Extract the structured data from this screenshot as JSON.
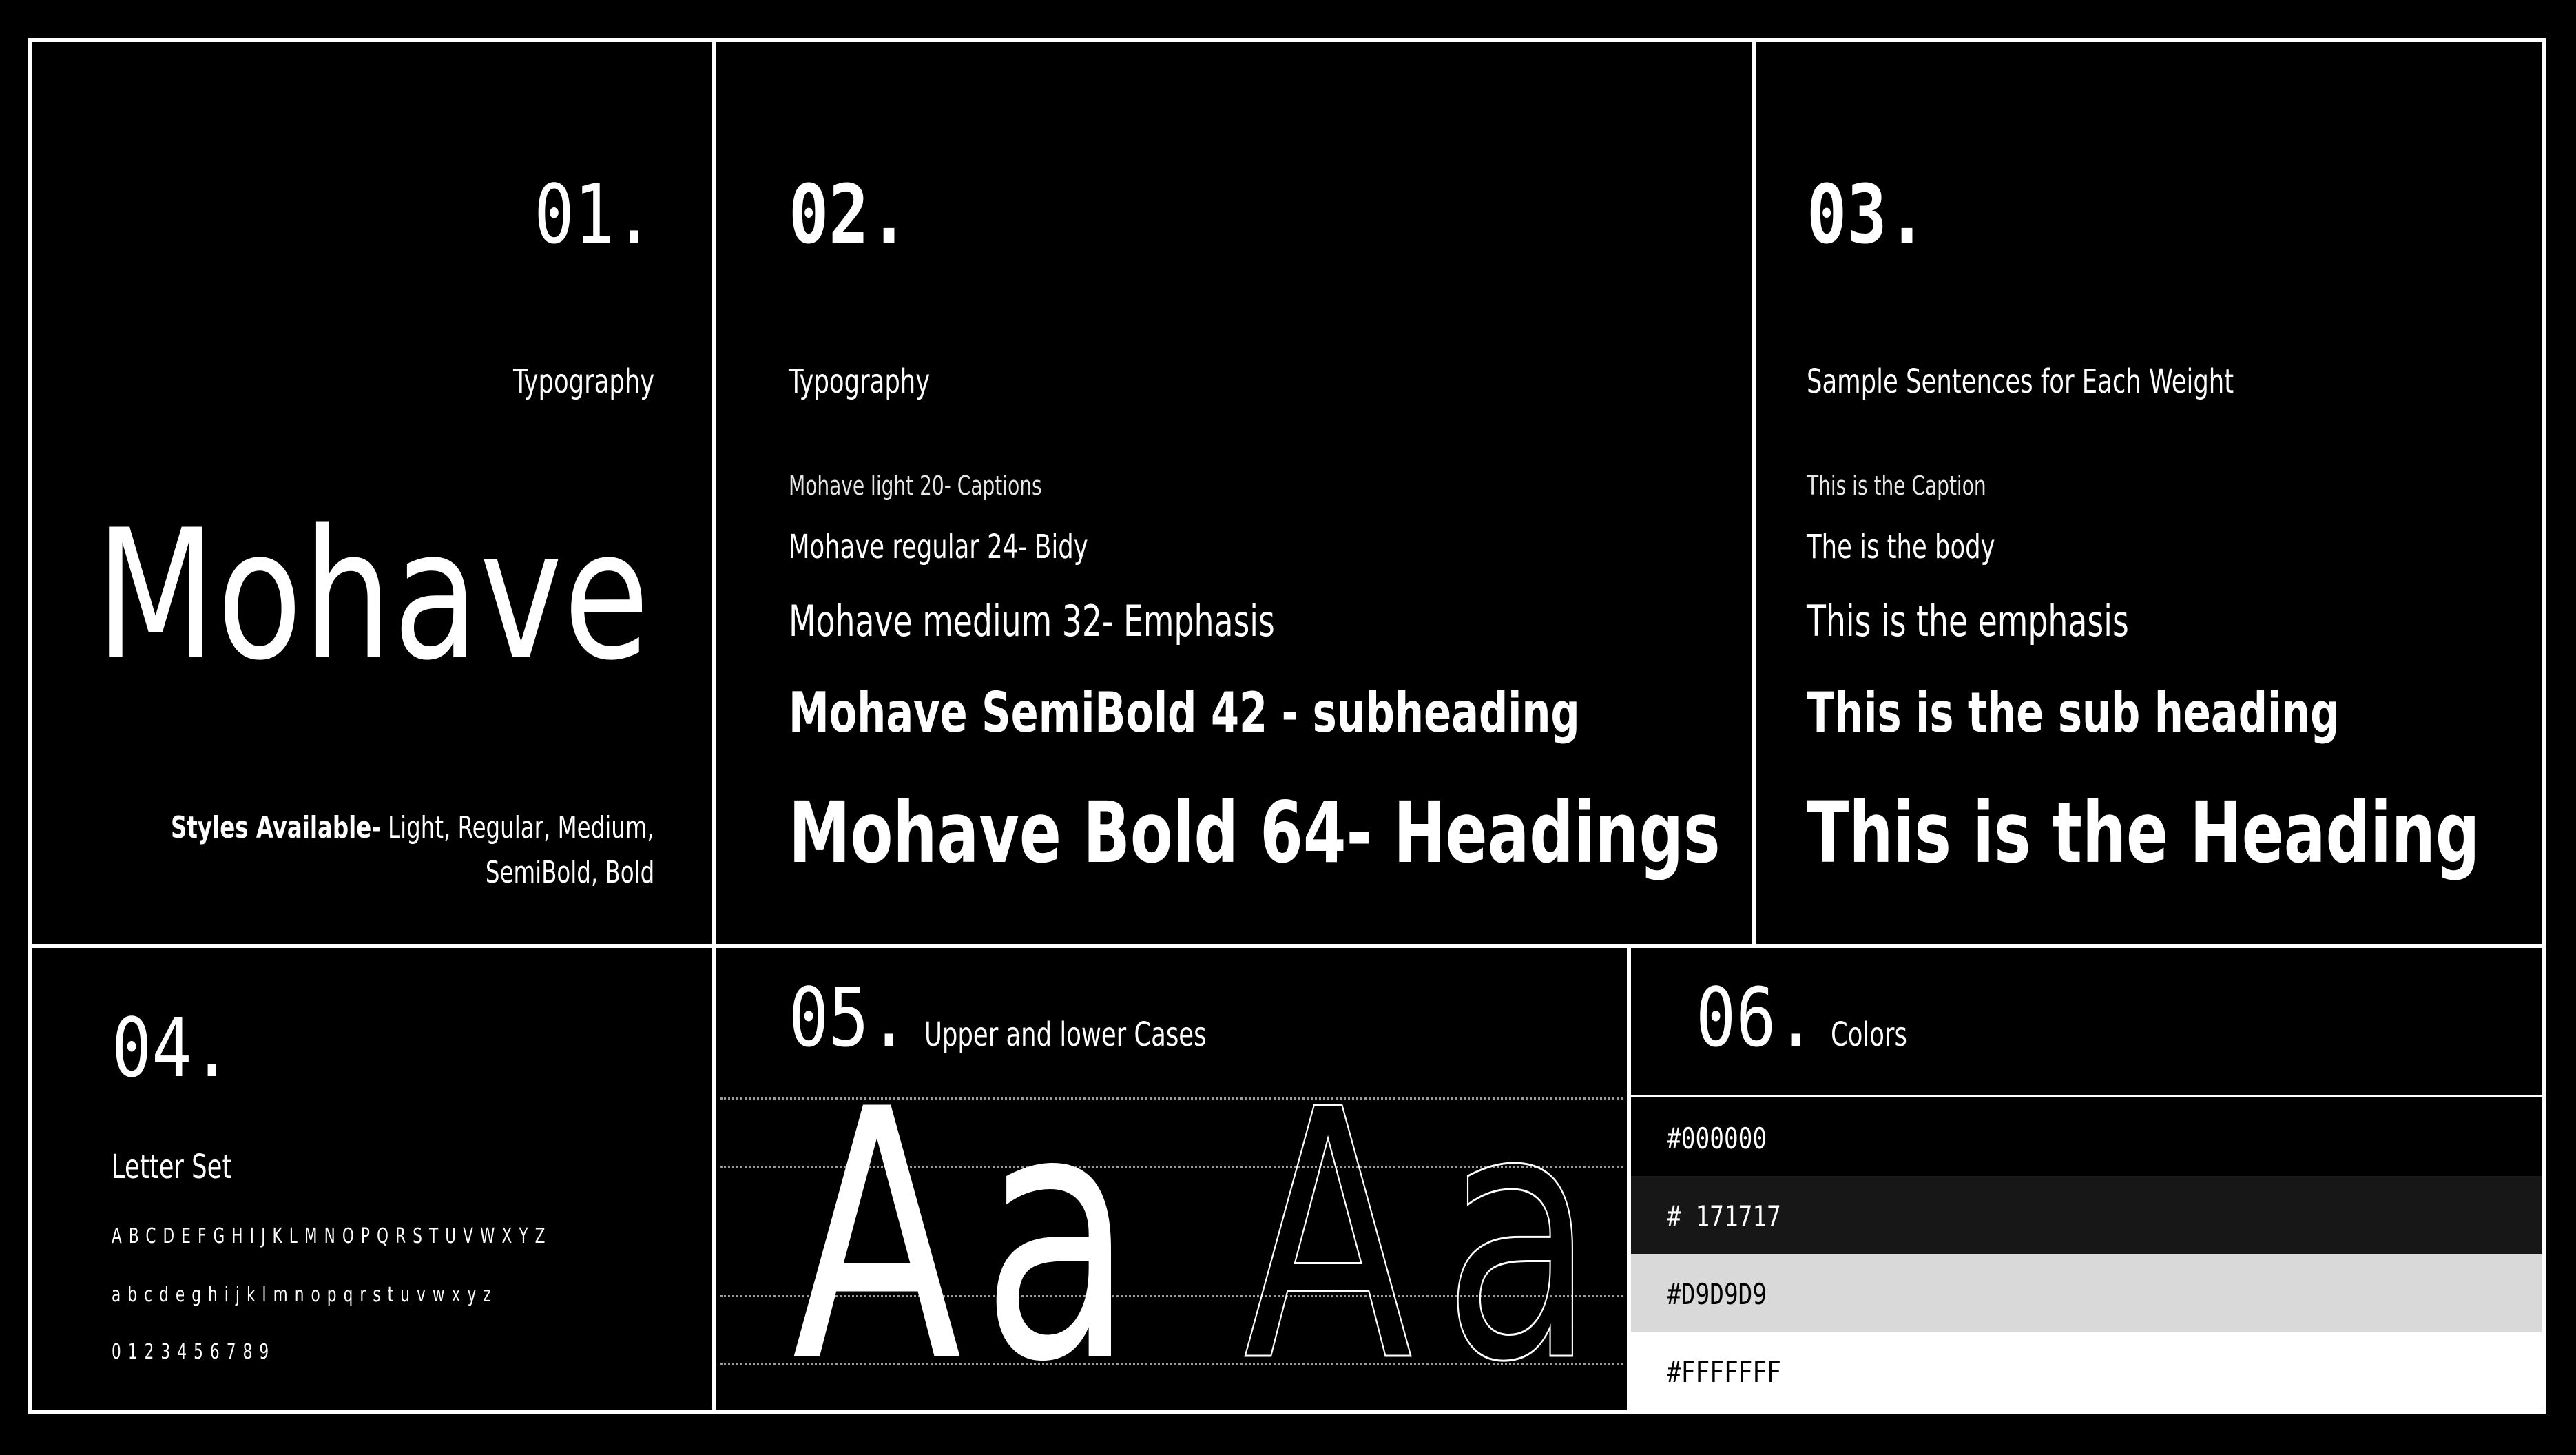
{
  "panel01": {
    "number": "01.",
    "label": "Typography",
    "font_name": "Mohave",
    "styles_prefix": "Styles Available-",
    "styles_line1": " Light, Regular, Medium,",
    "styles_line2": "SemiBold, Bold"
  },
  "panel02": {
    "number": "02.",
    "label": "Typography",
    "samples": [
      "Mohave light 20- Captions",
      "Mohave regular 24- Bidy",
      "Mohave medium 32- Emphasis",
      "Mohave SemiBold 42 - subheading",
      "Mohave Bold 64- Headings"
    ]
  },
  "panel03": {
    "number": "03.",
    "label": "Sample Sentences for Each Weight",
    "samples": [
      "This is the Caption",
      "The is the body",
      "This is the emphasis",
      "This is the sub heading",
      "This is the Heading"
    ]
  },
  "panel04": {
    "number": "04.",
    "label": "Letter Set",
    "uppercase": "ABCDEFGHIJKLMNOPQRSTUVWXYZ",
    "lowercase": "abcdeghijklmnopqrstuvwxyz",
    "digits": "0123456789"
  },
  "panel05": {
    "number": "05.",
    "label": "Upper and lower Cases",
    "filled_sample": "Aa",
    "outline_upper": "A",
    "outline_lower": "a"
  },
  "panel06": {
    "number": "06.",
    "label": "Colors",
    "swatches": [
      {
        "label": "#000000",
        "color": "#000000",
        "text_color": "#FFFFFF"
      },
      {
        "label": "# 171717",
        "color": "#171717",
        "text_color": "#FFFFFF"
      },
      {
        "label": "#D9D9D9",
        "color": "#D9D9D9",
        "text_color": "#000000"
      },
      {
        "label": "#FFFFFFF",
        "color": "#FFFFFF",
        "text_color": "#000000"
      }
    ]
  }
}
